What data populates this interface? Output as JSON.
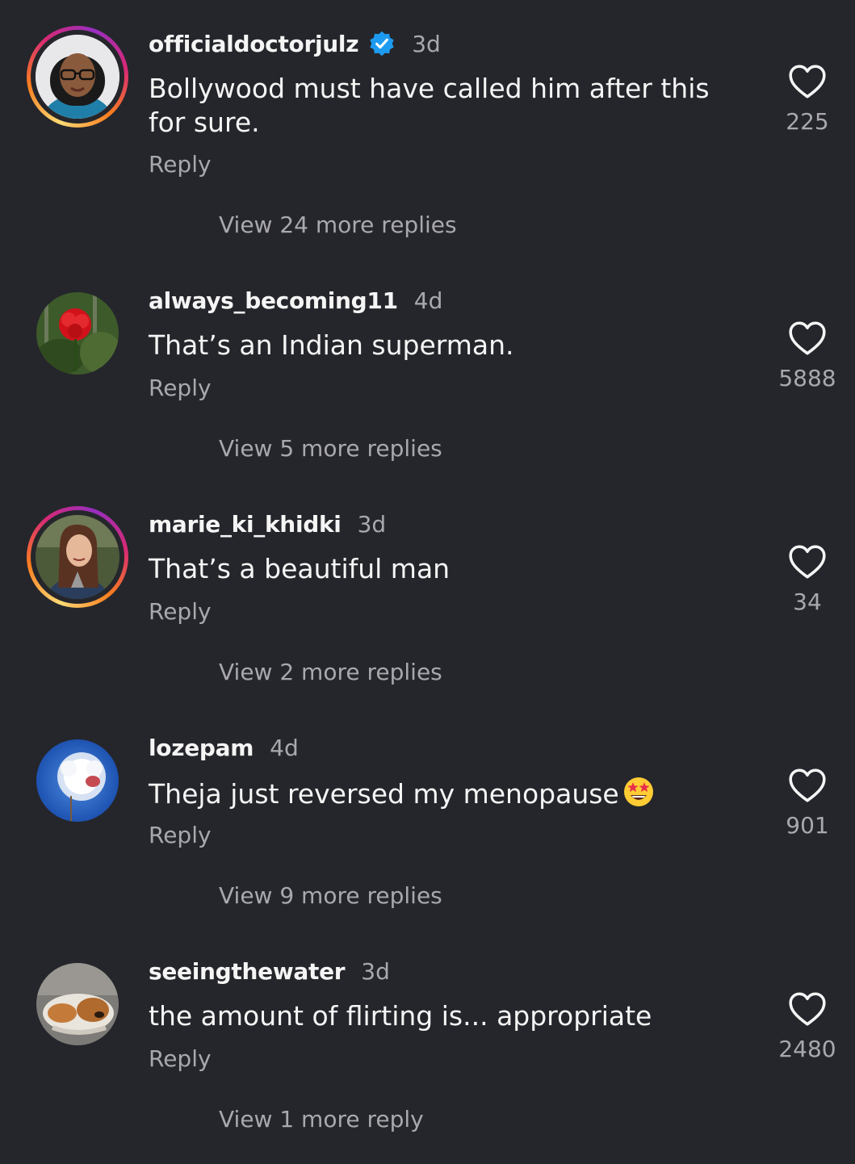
{
  "comments": [
    {
      "username": "officialdoctorjulz",
      "verified": true,
      "time": "3d",
      "text": "Bollywood must have called him after this for sure.",
      "reply_label": "Reply",
      "likes": "225",
      "view_replies": "View 24 more replies",
      "story_ring": true
    },
    {
      "username": "always_becoming11",
      "verified": false,
      "time": "4d",
      "text": "That’s an Indian superman.",
      "reply_label": "Reply",
      "likes": "5888",
      "view_replies": "View 5 more replies",
      "story_ring": false
    },
    {
      "username": "marie_ki_khidki",
      "verified": false,
      "time": "3d",
      "text": "That’s a beautiful man",
      "reply_label": "Reply",
      "likes": "34",
      "view_replies": "View 2 more replies",
      "story_ring": true
    },
    {
      "username": "lozepam",
      "verified": false,
      "time": "4d",
      "text": "Theja just reversed my menopause",
      "emoji": "star-struck-emoji",
      "reply_label": "Reply",
      "likes": "901",
      "view_replies": "View 9 more replies",
      "story_ring": false
    },
    {
      "username": "seeingthewater",
      "verified": false,
      "time": "3d",
      "text": "the amount of flirting is... appropriate",
      "reply_label": "Reply",
      "likes": "2480",
      "view_replies": "View 1 more reply",
      "story_ring": false
    }
  ],
  "icons": {
    "like": "heart-outline-icon",
    "verified": "verified-badge-icon"
  },
  "colors": {
    "background": "#25262b",
    "primary_text": "#f5f5f5",
    "secondary_text": "#a8a8ad",
    "verified_blue": "#1d9bf0"
  }
}
